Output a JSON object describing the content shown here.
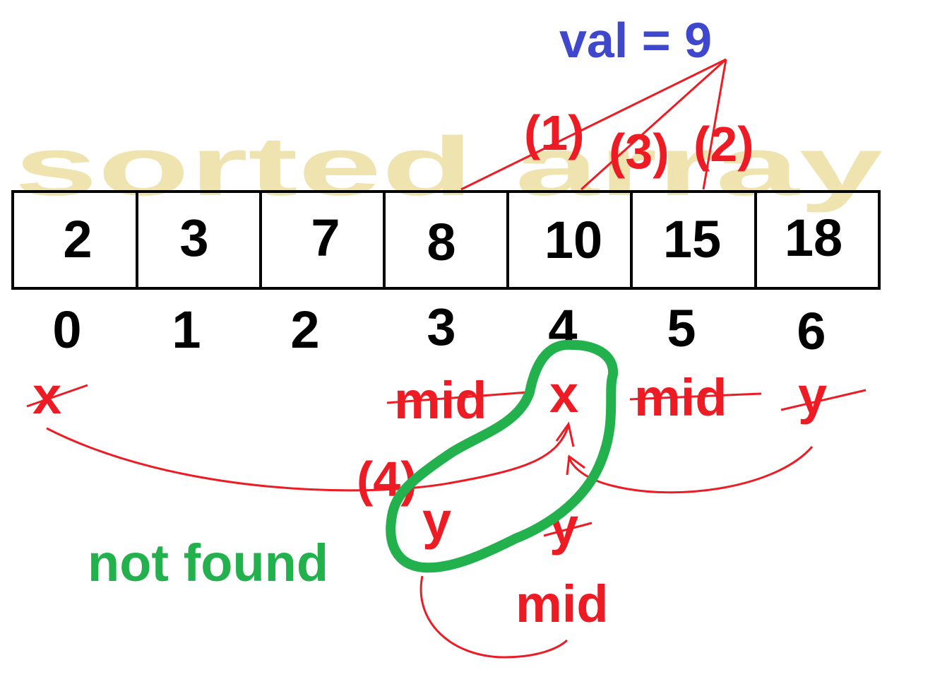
{
  "target_label": "val = 9",
  "watermark": "sorted array",
  "array": {
    "values": [
      "2",
      "3",
      "7",
      "8",
      "10",
      "15",
      "18"
    ],
    "indices": [
      "0",
      "1",
      "2",
      "3",
      "4",
      "5",
      "6"
    ]
  },
  "steps": [
    "(1)",
    "(2)",
    "(3)",
    "(4)"
  ],
  "pointers": {
    "x_start": "x",
    "mid_first": "mid",
    "x_final": "x",
    "mid_second": "mid",
    "y_start": "y",
    "y_final": "y",
    "y_mid": "y",
    "mid_last": "mid"
  },
  "result_label": "not found",
  "colors": {
    "target": "#3f48cc",
    "annotation": "#ed1c24",
    "result": "#22b14c",
    "watermark": "#efe4b0",
    "cell_border": "#000000",
    "text": "#000000"
  }
}
